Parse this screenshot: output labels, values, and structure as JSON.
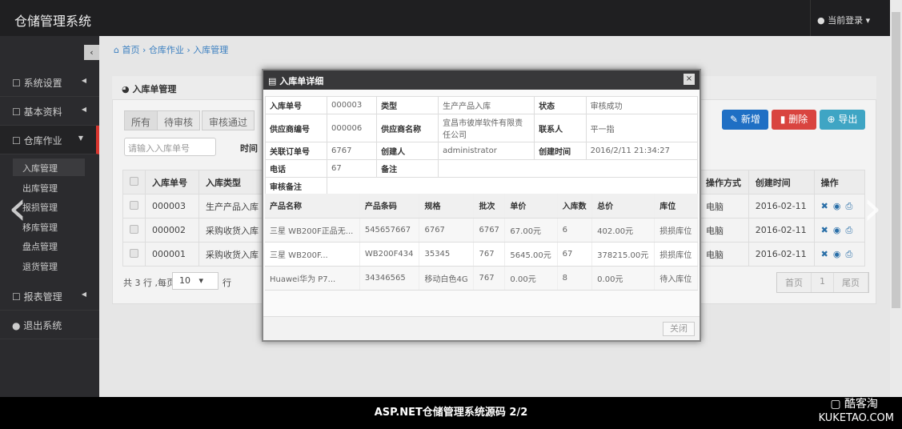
{
  "app": {
    "title": "仓储管理系统",
    "user": "当前登录"
  },
  "sidebar": {
    "collapse": "‹",
    "items": [
      {
        "label": "系统设置"
      },
      {
        "label": "基本资料"
      },
      {
        "label": "仓库作业"
      },
      {
        "label": "报表管理"
      },
      {
        "label": "退出系统"
      }
    ],
    "sub": [
      "入库管理",
      "出库管理",
      "报损管理",
      "移库管理",
      "盘点管理",
      "退货管理"
    ]
  },
  "breadcrumb": {
    "home": "首页",
    "l1": "仓库作业",
    "l2": "入库管理"
  },
  "panel": {
    "title": "入库单管理",
    "tabs": [
      "所有",
      "待审核",
      "审核通过"
    ],
    "search_placeholder": "请输入入库单号",
    "time_label": "时间",
    "buttons": {
      "add": "新增",
      "delete": "删除",
      "export": "导出"
    },
    "columns": [
      "入库单号",
      "入库类型",
      "操作方式",
      "创建时间",
      "操作"
    ],
    "rows": [
      {
        "no": "000003",
        "type": "生产产品入库",
        "mode": "电脑",
        "date": "2016-02-11"
      },
      {
        "no": "000002",
        "type": "采购收货入库",
        "mode": "电脑",
        "date": "2016-02-11"
      },
      {
        "no": "000001",
        "type": "采购收货入库",
        "mode": "电脑",
        "date": "2016-02-11"
      }
    ],
    "footer": {
      "total": "共 3 行 ,每页",
      "page_size": "10",
      "unit": "行"
    },
    "pager": {
      "first": "首页",
      "current": "1",
      "last": "尾页"
    }
  },
  "modal": {
    "title": "入库单详细",
    "close_x": "×",
    "info": {
      "no_k": "入库单号",
      "no": "000003",
      "type_k": "类型",
      "type": "生产产品入库",
      "status_k": "状态",
      "status": "审核成功",
      "sup_no_k": "供应商编号",
      "sup_no": "000006",
      "sup_name_k": "供应商名称",
      "sup_name": "宜昌市彼岸软件有限责任公司",
      "contact_k": "联系人",
      "contact": "平一指",
      "order_k": "关联订单号",
      "order": "6767",
      "creator_k": "创建人",
      "creator": "administrator",
      "ctime_k": "创建时间",
      "ctime": "2016/2/11 21:34:27",
      "phone_k": "电话",
      "phone": "67",
      "remark_k": "备注",
      "audit_k": "审核备注"
    },
    "columns": [
      "产品名称",
      "产品条码",
      "规格",
      "批次",
      "单价",
      "入库数",
      "总价",
      "库位"
    ],
    "rows": [
      [
        "三星 WB200F正品无...",
        "545657667",
        "6767",
        "6767",
        "67.00元",
        "6",
        "402.00元",
        "损损库位"
      ],
      [
        "三星 WB200F...",
        "WB200F434",
        "35345",
        "767",
        "5645.00元",
        "67",
        "378215.00元",
        "损损库位"
      ],
      [
        "Huawei华为 P7...",
        "34346565",
        "移动白色4G",
        "767",
        "0.00元",
        "8",
        "0.00元",
        "待入库位"
      ]
    ],
    "close": "关闭"
  },
  "caption": "ASP.NET仓储管理系统源码   2/2",
  "watermark": {
    "name": "酷客淘",
    "url": "KUKETAO.COM"
  }
}
